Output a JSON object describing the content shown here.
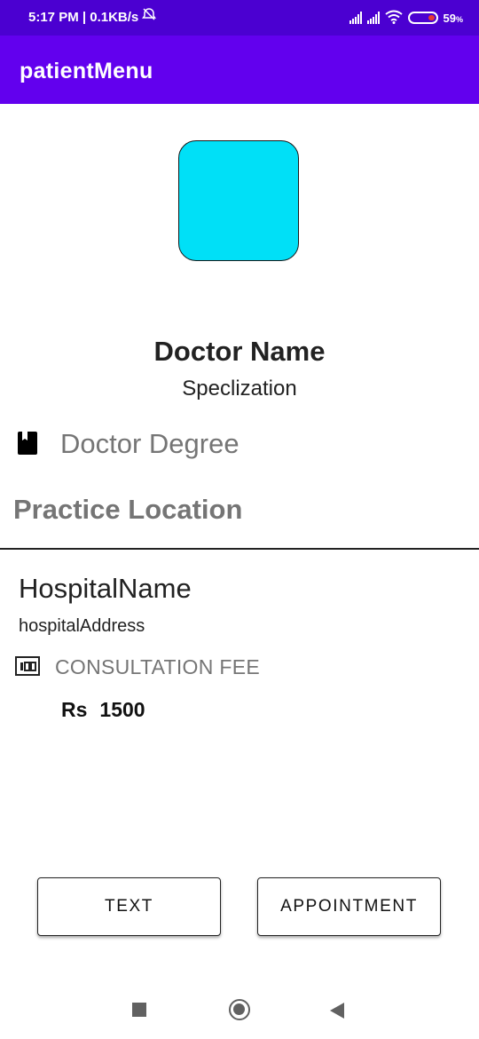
{
  "status_bar": {
    "time_speed": "5:17 PM | 0.1KB/s",
    "alarm_icon": "alarm-off-icon",
    "battery_percent": "59",
    "battery_suffix": "%",
    "battery_level": 0.59
  },
  "app_bar": {
    "title": "patientMenu"
  },
  "doctor": {
    "name": "Doctor Name",
    "specialization": "Speclization",
    "degree_icon": "book-icon",
    "degree": "Doctor Degree"
  },
  "practice": {
    "section_title": "Practice Location",
    "hospital_name": "HospitalName",
    "hospital_address": "hospitalAddress",
    "fee_icon": "cash-icon",
    "fee_label": "CONSULTATION FEE",
    "currency": "Rs",
    "fee_amount": "1500"
  },
  "actions": {
    "text_label": "TEXT",
    "appointment_label": "APPOINTMENT"
  },
  "colors": {
    "status_bar": "#4b00d1",
    "app_bar": "#6200ee",
    "avatar": "#00e0f7"
  }
}
